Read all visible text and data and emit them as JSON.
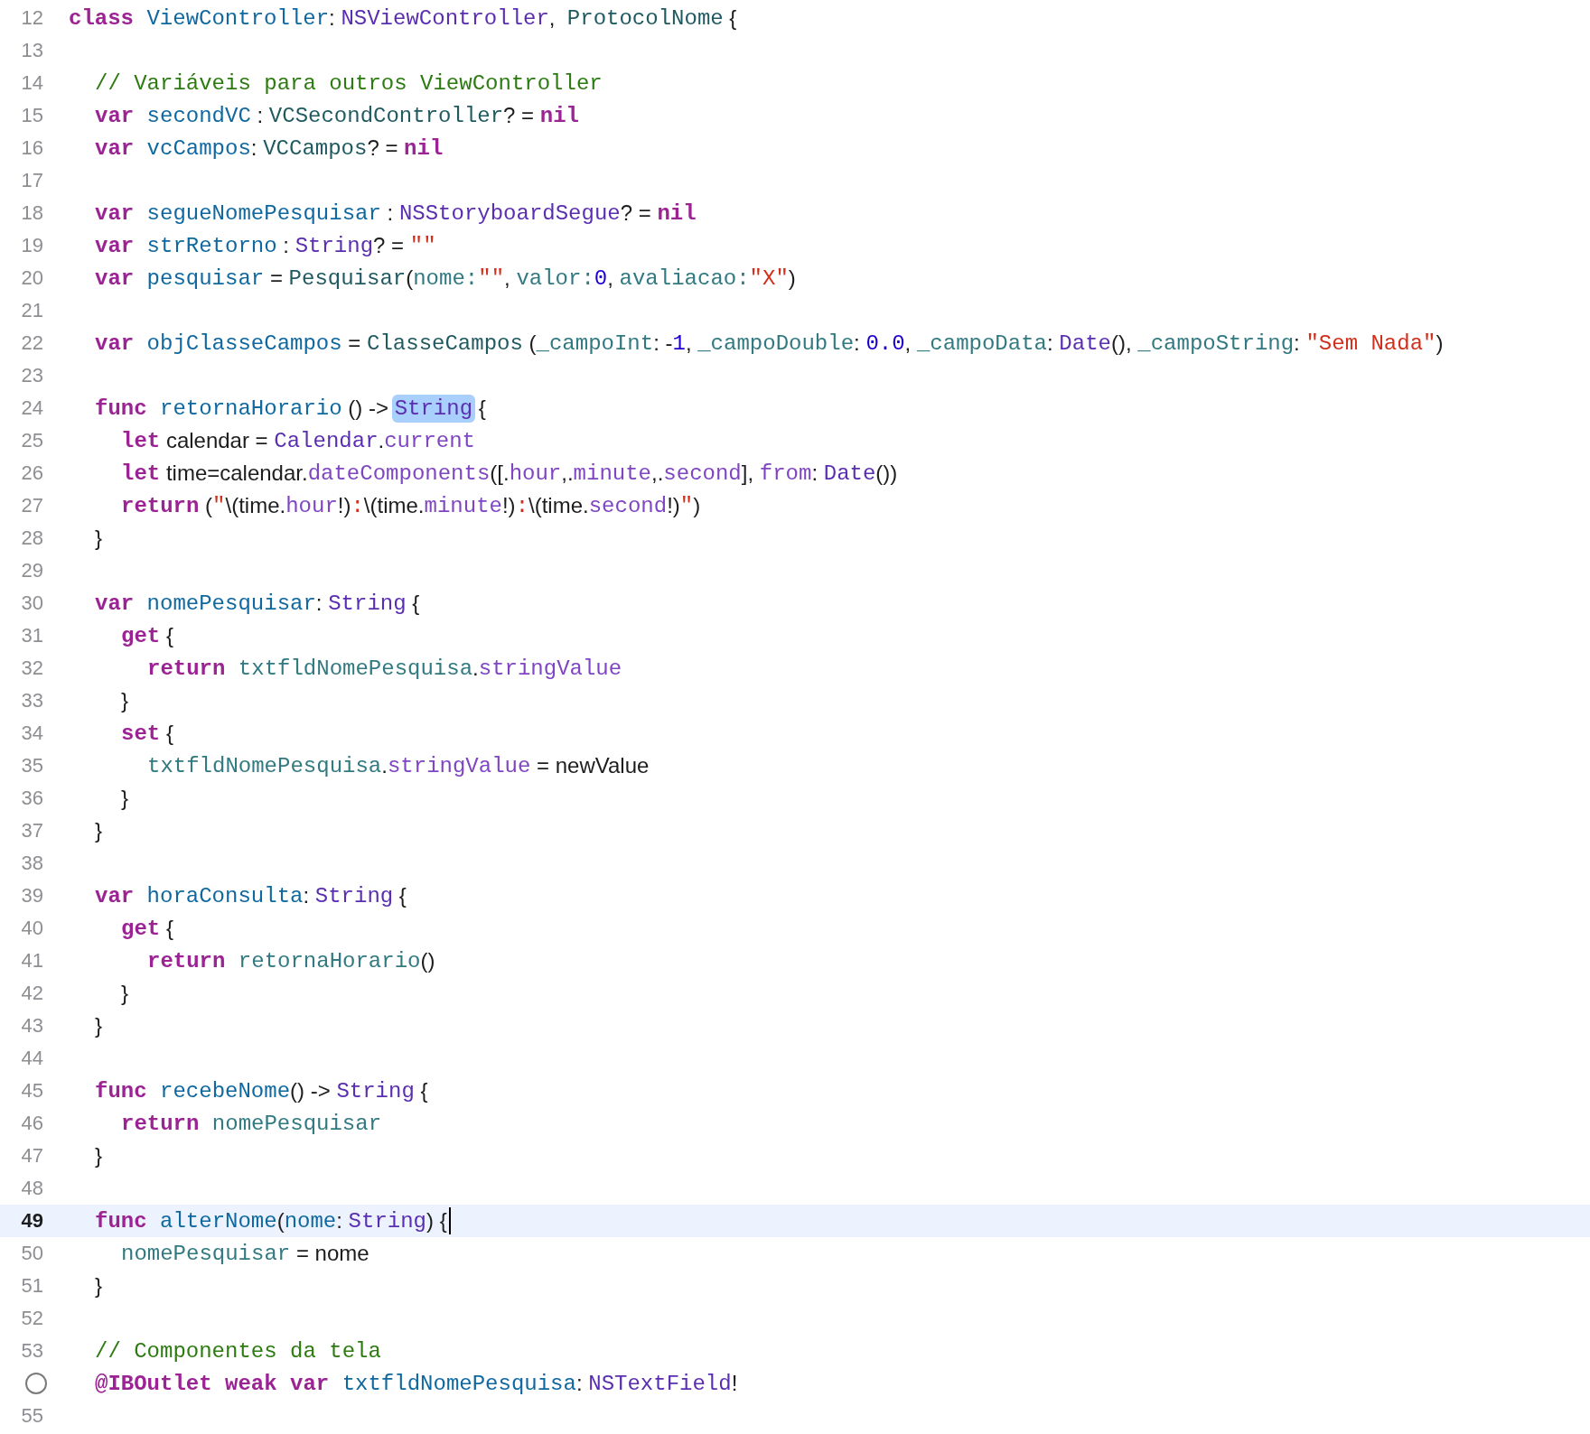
{
  "editor": {
    "lines": [
      {
        "number": "12",
        "current": false,
        "tokens": [
          {
            "text": "class ",
            "kind": "keyword"
          },
          {
            "text": "ViewController",
            "kind": "decl"
          },
          {
            "text": ": ",
            "kind": "plain"
          },
          {
            "text": "NSViewController",
            "kind": "systype"
          },
          {
            "text": ",  ",
            "kind": "plain"
          },
          {
            "text": "ProtocolNome",
            "kind": "projtype"
          },
          {
            "text": " {",
            "kind": "plain"
          }
        ],
        "children": [
          {
            "number": "13",
            "current": false
          },
          {
            "number": "14",
            "current": false,
            "tokens": [
              {
                "text": "// Variáveis para outros ViewController",
                "kind": "comment"
              }
            ]
          },
          {
            "number": "15",
            "current": false,
            "tokens": [
              {
                "text": "var ",
                "kind": "keyword"
              },
              {
                "text": "secondVC",
                "kind": "decl"
              },
              {
                "text": " : ",
                "kind": "plain"
              },
              {
                "text": "VCSecondController",
                "kind": "projtype"
              },
              {
                "text": "? = ",
                "kind": "plain"
              },
              {
                "text": "nil",
                "kind": "keyword"
              }
            ]
          },
          {
            "number": "16",
            "current": false,
            "tokens": [
              {
                "text": "var ",
                "kind": "keyword"
              },
              {
                "text": "vcCampos",
                "kind": "decl"
              },
              {
                "text": ": ",
                "kind": "plain"
              },
              {
                "text": "VCCampos",
                "kind": "projtype"
              },
              {
                "text": "? = ",
                "kind": "plain"
              },
              {
                "text": "nil",
                "kind": "keyword"
              }
            ]
          },
          {
            "number": "17",
            "current": false
          },
          {
            "number": "18",
            "current": false,
            "tokens": [
              {
                "text": "var ",
                "kind": "keyword"
              },
              {
                "text": "segueNomePesquisar",
                "kind": "decl"
              },
              {
                "text": " : ",
                "kind": "plain"
              },
              {
                "text": "NSStoryboardSegue",
                "kind": "systype"
              },
              {
                "text": "? = ",
                "kind": "plain"
              },
              {
                "text": "nil",
                "kind": "keyword"
              }
            ]
          },
          {
            "number": "19",
            "current": false,
            "tokens": [
              {
                "text": "var ",
                "kind": "keyword"
              },
              {
                "text": "strRetorno",
                "kind": "decl"
              },
              {
                "text": " : ",
                "kind": "plain"
              },
              {
                "text": "String",
                "kind": "systype"
              },
              {
                "text": "? = ",
                "kind": "plain"
              },
              {
                "text": "\"\"",
                "kind": "string"
              }
            ]
          },
          {
            "number": "20",
            "current": false,
            "tokens": [
              {
                "text": "var ",
                "kind": "keyword"
              },
              {
                "text": "pesquisar",
                "kind": "decl"
              },
              {
                "text": " = ",
                "kind": "plain"
              },
              {
                "text": "Pesquisar",
                "kind": "projtype"
              },
              {
                "text": "(",
                "kind": "plain"
              },
              {
                "text": "nome:",
                "kind": "member"
              },
              {
                "text": "\"\"",
                "kind": "string"
              },
              {
                "text": ", ",
                "kind": "plain"
              },
              {
                "text": "valor:",
                "kind": "member"
              },
              {
                "text": "0",
                "kind": "number"
              },
              {
                "text": ", ",
                "kind": "plain"
              },
              {
                "text": "avaliacao:",
                "kind": "member"
              },
              {
                "text": "\"X\"",
                "kind": "string"
              },
              {
                "text": ")",
                "kind": "plain"
              }
            ]
          },
          {
            "number": "21",
            "current": false
          },
          {
            "number": "22",
            "current": false,
            "tokens": [
              {
                "text": "var ",
                "kind": "keyword"
              },
              {
                "text": "objClasseCampos",
                "kind": "decl"
              },
              {
                "text": " = ",
                "kind": "plain"
              },
              {
                "text": "ClasseCampos",
                "kind": "projtype"
              },
              {
                "text": " (",
                "kind": "plain"
              },
              {
                "text": "_campoInt",
                "kind": "member"
              },
              {
                "text": ": -",
                "kind": "plain"
              },
              {
                "text": "1",
                "kind": "number"
              },
              {
                "text": ", ",
                "kind": "plain"
              },
              {
                "text": "_campoDouble",
                "kind": "member"
              },
              {
                "text": ": ",
                "kind": "plain"
              },
              {
                "text": "0.0",
                "kind": "number"
              },
              {
                "text": ", ",
                "kind": "plain"
              },
              {
                "text": "_campoData",
                "kind": "member"
              },
              {
                "text": ": ",
                "kind": "plain"
              },
              {
                "text": "Date",
                "kind": "systype"
              },
              {
                "text": "(), ",
                "kind": "plain"
              },
              {
                "text": "_campoString",
                "kind": "member"
              },
              {
                "text": ": ",
                "kind": "plain"
              },
              {
                "text": "\"Sem Nada\"",
                "kind": "string"
              },
              {
                "text": ")",
                "kind": "plain"
              }
            ]
          },
          {
            "number": "23",
            "current": false
          },
          {
            "number": "24",
            "current": false,
            "tokens": [
              {
                "text": "func ",
                "kind": "keyword"
              },
              {
                "text": "retornaHorario",
                "kind": "decl"
              },
              {
                "text": " () -> ",
                "kind": "plain"
              },
              {
                "text": "String",
                "kind": "match"
              },
              {
                "text": " {",
                "kind": "plain"
              }
            ],
            "children": [
              {
                "number": "25",
                "current": false,
                "tokens": [
                  {
                    "text": "let",
                    "kind": "keyword"
                  },
                  {
                    "text": " calendar = ",
                    "kind": "plain"
                  },
                  {
                    "text": "Calendar",
                    "kind": "systype"
                  },
                  {
                    "text": ".",
                    "kind": "plain"
                  },
                  {
                    "text": "current",
                    "kind": "sysmember"
                  }
                ]
              },
              {
                "number": "26",
                "current": false,
                "tokens": [
                  {
                    "text": "let",
                    "kind": "keyword"
                  },
                  {
                    "text": " time=calendar.",
                    "kind": "plain"
                  },
                  {
                    "text": "dateComponents",
                    "kind": "sysmember"
                  },
                  {
                    "text": "([.",
                    "kind": "plain"
                  },
                  {
                    "text": "hour",
                    "kind": "sysmember"
                  },
                  {
                    "text": ",.",
                    "kind": "plain"
                  },
                  {
                    "text": "minute",
                    "kind": "sysmember"
                  },
                  {
                    "text": ",.",
                    "kind": "plain"
                  },
                  {
                    "text": "second",
                    "kind": "sysmember"
                  },
                  {
                    "text": "], ",
                    "kind": "plain"
                  },
                  {
                    "text": "from",
                    "kind": "sysmember"
                  },
                  {
                    "text": ": ",
                    "kind": "plain"
                  },
                  {
                    "text": "Date",
                    "kind": "systype"
                  },
                  {
                    "text": "())",
                    "kind": "plain"
                  }
                ]
              },
              {
                "number": "27",
                "current": false,
                "tokens": [
                  {
                    "text": "return",
                    "kind": "keyword"
                  },
                  {
                    "text": " (",
                    "kind": "plain"
                  },
                  {
                    "text": "\"",
                    "kind": "string"
                  },
                  {
                    "text": "\\(time.",
                    "kind": "plain"
                  },
                  {
                    "text": "hour",
                    "kind": "sysmember"
                  },
                  {
                    "text": "!)",
                    "kind": "plain"
                  },
                  {
                    "text": ":",
                    "kind": "string"
                  },
                  {
                    "text": "\\(time.",
                    "kind": "plain"
                  },
                  {
                    "text": "minute",
                    "kind": "sysmember"
                  },
                  {
                    "text": "!)",
                    "kind": "plain"
                  },
                  {
                    "text": ":",
                    "kind": "string"
                  },
                  {
                    "text": "\\(time.",
                    "kind": "plain"
                  },
                  {
                    "text": "second",
                    "kind": "sysmember"
                  },
                  {
                    "text": "!)",
                    "kind": "plain"
                  },
                  {
                    "text": "\"",
                    "kind": "string"
                  },
                  {
                    "text": ")",
                    "kind": "plain"
                  }
                ]
              }
            ]
          },
          {
            "number": "28",
            "current": false,
            "tokens": [
              {
                "text": "}",
                "kind": "plain"
              }
            ]
          },
          {
            "number": "29",
            "current": false
          },
          {
            "number": "30",
            "current": false,
            "tokens": [
              {
                "text": "var ",
                "kind": "keyword"
              },
              {
                "text": "nomePesquisar",
                "kind": "decl"
              },
              {
                "text": ": ",
                "kind": "plain"
              },
              {
                "text": "String",
                "kind": "systype"
              },
              {
                "text": " {",
                "kind": "plain"
              }
            ],
            "children": [
              {
                "number": "31",
                "current": false,
                "tokens": [
                  {
                    "text": "get",
                    "kind": "keyword"
                  },
                  {
                    "text": " {",
                    "kind": "plain"
                  }
                ],
                "children": [
                  {
                    "number": "32",
                    "current": false,
                    "tokens": [
                      {
                        "text": "return ",
                        "kind": "keyword"
                      },
                      {
                        "text": "txtfldNomePesquisa",
                        "kind": "member"
                      },
                      {
                        "text": ".",
                        "kind": "plain"
                      },
                      {
                        "text": "stringValue",
                        "kind": "sysmember"
                      }
                    ]
                  }
                ]
              },
              {
                "number": "33",
                "current": false,
                "tokens": [
                  {
                    "text": "}",
                    "kind": "plain"
                  }
                ]
              },
              {
                "number": "34",
                "current": false,
                "tokens": [
                  {
                    "text": "set",
                    "kind": "keyword"
                  },
                  {
                    "text": " {",
                    "kind": "plain"
                  }
                ],
                "children": [
                  {
                    "number": "35",
                    "current": false,
                    "tokens": [
                      {
                        "text": "txtfldNomePesquisa",
                        "kind": "member"
                      },
                      {
                        "text": ".",
                        "kind": "plain"
                      },
                      {
                        "text": "stringValue",
                        "kind": "sysmember"
                      },
                      {
                        "text": " = newValue",
                        "kind": "plain"
                      }
                    ]
                  }
                ]
              },
              {
                "number": "36",
                "current": false,
                "tokens": [
                  {
                    "text": "}",
                    "kind": "plain"
                  }
                ]
              }
            ]
          },
          {
            "number": "37",
            "current": false,
            "tokens": [
              {
                "text": "}",
                "kind": "plain"
              }
            ]
          },
          {
            "number": "38",
            "current": false
          },
          {
            "number": "39",
            "current": false,
            "tokens": [
              {
                "text": "var ",
                "kind": "keyword"
              },
              {
                "text": "horaConsulta",
                "kind": "decl"
              },
              {
                "text": ": ",
                "kind": "plain"
              },
              {
                "text": "String",
                "kind": "systype"
              },
              {
                "text": " {",
                "kind": "plain"
              }
            ],
            "children": [
              {
                "number": "40",
                "current": false,
                "tokens": [
                  {
                    "text": "get",
                    "kind": "keyword"
                  },
                  {
                    "text": " {",
                    "kind": "plain"
                  }
                ],
                "children": [
                  {
                    "number": "41",
                    "current": false,
                    "tokens": [
                      {
                        "text": "return ",
                        "kind": "keyword"
                      },
                      {
                        "text": "retornaHorario",
                        "kind": "member"
                      },
                      {
                        "text": "()",
                        "kind": "plain"
                      }
                    ]
                  }
                ]
              },
              {
                "number": "42",
                "current": false,
                "tokens": [
                  {
                    "text": "}",
                    "kind": "plain"
                  }
                ]
              }
            ]
          },
          {
            "number": "43",
            "current": false,
            "tokens": [
              {
                "text": "}",
                "kind": "plain"
              }
            ]
          },
          {
            "number": "44",
            "current": false
          },
          {
            "number": "45",
            "current": false,
            "tokens": [
              {
                "text": "func ",
                "kind": "keyword"
              },
              {
                "text": "recebeNome",
                "kind": "decl"
              },
              {
                "text": "() -> ",
                "kind": "plain"
              },
              {
                "text": "String",
                "kind": "systype"
              },
              {
                "text": " {",
                "kind": "plain"
              }
            ],
            "children": [
              {
                "number": "46",
                "current": false,
                "tokens": [
                  {
                    "text": "return ",
                    "kind": "keyword"
                  },
                  {
                    "text": "nomePesquisar",
                    "kind": "member"
                  }
                ]
              }
            ]
          },
          {
            "number": "47",
            "current": false,
            "tokens": [
              {
                "text": "}",
                "kind": "plain"
              }
            ]
          },
          {
            "number": "48",
            "current": false
          },
          {
            "number": "49",
            "current": true,
            "tokens": [
              {
                "text": "func ",
                "kind": "keyword"
              },
              {
                "text": "alterNome",
                "kind": "decl"
              },
              {
                "text": "(",
                "kind": "plain"
              },
              {
                "text": "nome",
                "kind": "decl"
              },
              {
                "text": ": ",
                "kind": "plain"
              },
              {
                "text": "String",
                "kind": "systype"
              },
              {
                "text": ") {",
                "kind": "plain"
              }
            ],
            "children": [
              {
                "number": "50",
                "current": false,
                "tokens": [
                  {
                    "text": "nomePesquisar",
                    "kind": "member"
                  },
                  {
                    "text": " = nome",
                    "kind": "plain"
                  }
                ]
              }
            ]
          },
          {
            "number": "51",
            "current": false,
            "tokens": [
              {
                "text": "}",
                "kind": "plain"
              }
            ]
          },
          {
            "number": "52",
            "current": false
          },
          {
            "number": "53",
            "current": false,
            "tokens": [
              {
                "text": "// Componentes da tela",
                "kind": "comment"
              }
            ]
          },
          {
            "outlet": true,
            "current": false,
            "tokens": [
              {
                "text": "@IBOutlet ",
                "kind": "keyword"
              },
              {
                "text": "weak ",
                "kind": "keyword"
              },
              {
                "text": "var ",
                "kind": "keyword"
              },
              {
                "text": "txtfldNomePesquisa",
                "kind": "decl"
              },
              {
                "text": ": ",
                "kind": "plain"
              },
              {
                "text": "NSTextField",
                "kind": "systype"
              },
              {
                "text": "!",
                "kind": "plain"
              }
            ]
          },
          {
            "number": "55",
            "current": false
          }
        ]
      }
    ]
  }
}
